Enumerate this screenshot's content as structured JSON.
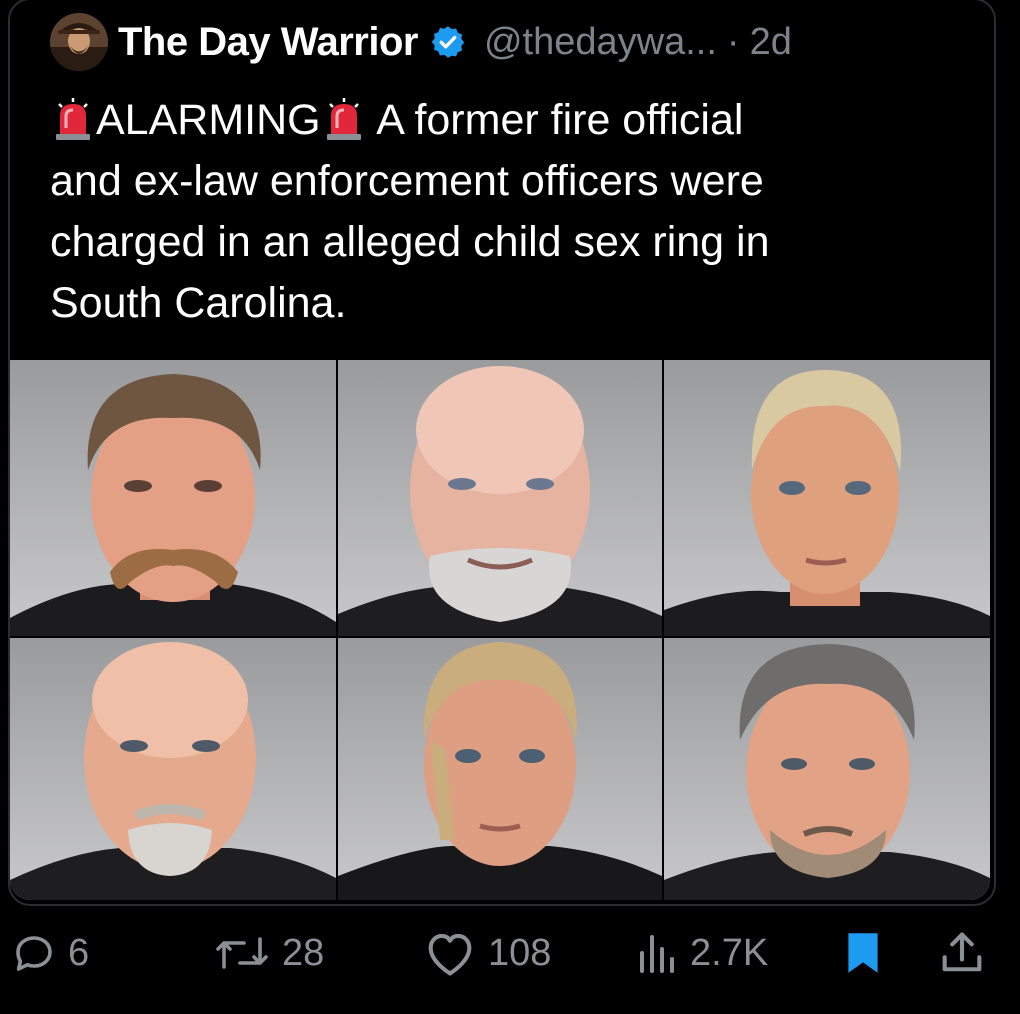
{
  "post": {
    "author_name": "The Day Warrior",
    "handle": "@thedaywa...",
    "separator": "·",
    "timestamp": "2d",
    "text_lines": [
      "ALARMING",
      "A former fire official",
      "and ex-law enforcement officers were",
      "charged in an alleged child sex ring in",
      "South Carolina."
    ],
    "text_icons": [
      "siren-emoji",
      "siren-emoji"
    ],
    "media": {
      "layout": "2x3 grid",
      "mugshots": [
        {
          "feature": "mustache",
          "hair": "brown-short"
        },
        {
          "feature": "gray-beard",
          "hair": "bald"
        },
        {
          "feature": "none",
          "hair": "blonde-pulled-back"
        },
        {
          "feature": "goatee",
          "hair": "bald"
        },
        {
          "feature": "none",
          "hair": "blonde-short"
        },
        {
          "feature": "stubble",
          "hair": "gray-short"
        }
      ]
    }
  },
  "actions": {
    "replies": "6",
    "reposts": "28",
    "likes": "108",
    "views": "2.7K"
  },
  "icons": {
    "reply": "reply-icon",
    "repost": "repost-icon",
    "like": "heart-icon",
    "views": "views-icon",
    "bookmark": "bookmark-icon",
    "share": "share-icon",
    "verified": "verified-badge-icon"
  },
  "colors": {
    "background": "#000000",
    "text": "#ffffff",
    "muted": "#7d838a",
    "verified": "#1d9bf0",
    "bookmark_active": "#1d9bf0",
    "siren_red": "#e0283a"
  }
}
